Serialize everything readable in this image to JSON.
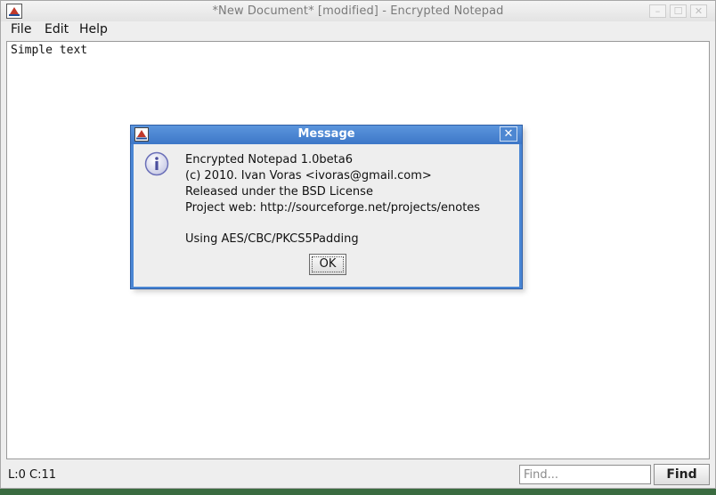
{
  "window": {
    "title": "*New Document* [modified] - Encrypted Notepad",
    "controls": {
      "minimize": "–",
      "maximize": "☐",
      "close": "✕"
    }
  },
  "menu": {
    "file": "File",
    "edit": "Edit",
    "help": "Help"
  },
  "editor": {
    "content": "Simple text"
  },
  "status": {
    "position": "L:0 C:11"
  },
  "find": {
    "placeholder": "Find...",
    "button_label": "Find"
  },
  "dialog": {
    "title": "Message",
    "close_glyph": "✕",
    "lines": [
      "Encrypted Notepad 1.0beta6",
      "(c) 2010. Ivan Voras <ivoras@gmail.com>",
      "Released under the BSD License",
      "Project web: http://sourceforge.net/projects/enotes",
      "Using AES/CBC/PKCS5Padding"
    ],
    "ok_label": "OK"
  },
  "colors": {
    "dialog_title_bg": "#4a86d4",
    "window_bg": "#eeeeee",
    "desktop": "#3a6b40"
  },
  "icons": {
    "app": "java-app-icon",
    "info": "information-icon"
  }
}
